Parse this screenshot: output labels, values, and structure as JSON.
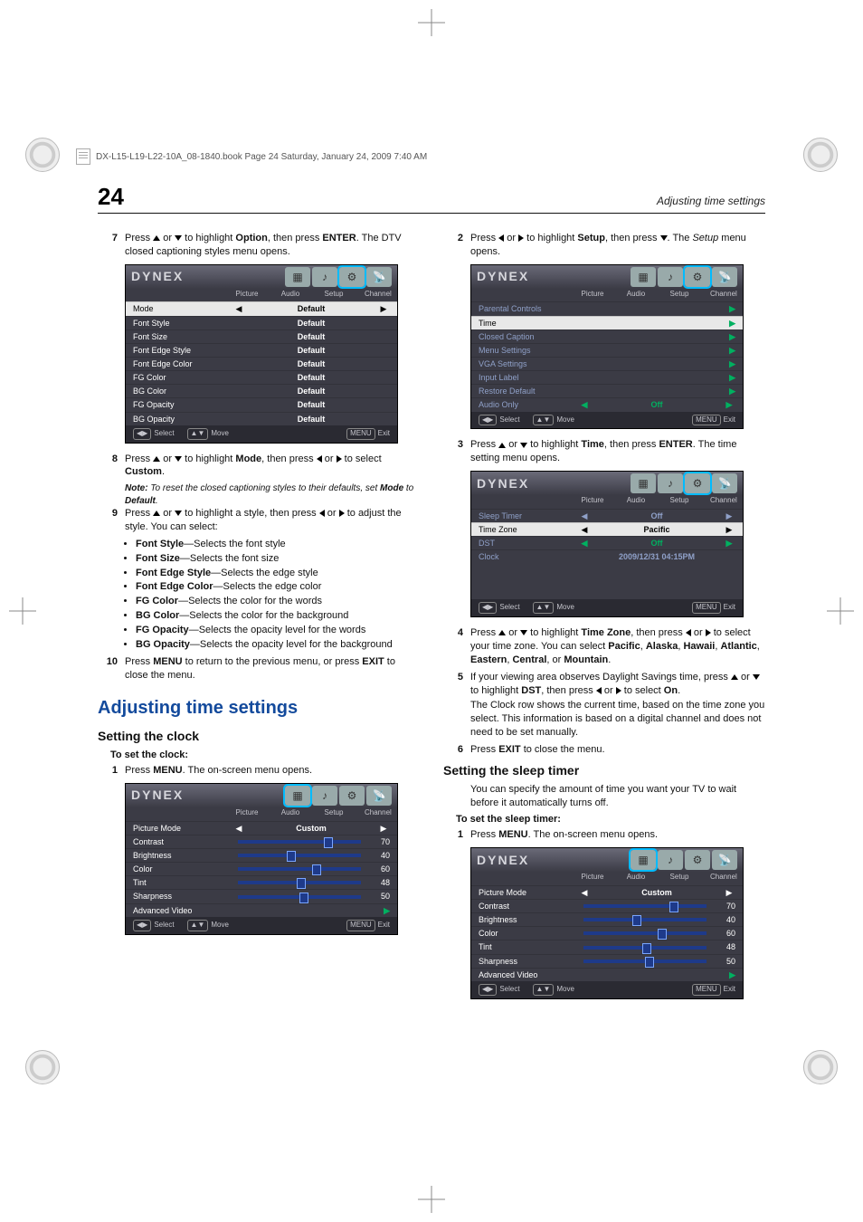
{
  "header_strip": "DX-L15-L19-L22-10A_08-1840.book  Page 24  Saturday, January 24, 2009  7:40 AM",
  "page_number": "24",
  "running_head": "Adjusting time settings",
  "brand": "DYNEX",
  "tab_labels": {
    "picture": "Picture",
    "audio": "Audio",
    "setup": "Setup",
    "channel": "Channel"
  },
  "osd_foot": {
    "select": "Select",
    "move": "Move",
    "menu": "MENU",
    "exit": "Exit"
  },
  "left": {
    "step7_a": "Press ",
    "step7_b": " or ",
    "step7_c": " to highlight ",
    "step7_opt": "Option",
    "step7_d": ", then press ",
    "step7_enter": "ENTER",
    "step7_e": ". The DTV closed captioning styles menu opens.",
    "osd1": {
      "rows": [
        {
          "k": "Mode",
          "v": "Default",
          "hl": true,
          "arrows": true
        },
        {
          "k": "Font Style",
          "v": "Default"
        },
        {
          "k": "Font Size",
          "v": "Default"
        },
        {
          "k": "Font Edge Style",
          "v": "Default"
        },
        {
          "k": "Font Edge Color",
          "v": "Default"
        },
        {
          "k": "FG Color",
          "v": "Default"
        },
        {
          "k": "BG Color",
          "v": "Default"
        },
        {
          "k": "FG Opacity",
          "v": "Default"
        },
        {
          "k": "BG Opacity",
          "v": "Default"
        }
      ]
    },
    "step8_a": "Press ",
    "step8_b": " or ",
    "step8_c": " to highlight ",
    "step8_mode": "Mode",
    "step8_d": ", then press ",
    "step8_e": " or ",
    "step8_f": " to select ",
    "step8_custom": "Custom",
    "note_a": "Note:",
    "note_b": " To reset the closed captioning styles to their defaults, set ",
    "note_c": "Mode",
    "note_d": " to ",
    "note_e": "Default",
    "step9_a": "Press ",
    "step9_b": " or ",
    "step9_c": " to highlight a style, then press ",
    "step9_d": " or ",
    "step9_e": " to adjust the style. You can select:",
    "b1": "Font Style",
    "b1t": "—Selects the font style",
    "b2": "Font Size",
    "b2t": "—Selects the font size",
    "b3": "Font Edge Style",
    "b3t": "—Selects the edge style",
    "b4": "Font Edge Color",
    "b4t": "—Selects the edge color",
    "b5": "FG Color",
    "b5t": "—Selects the color for the words",
    "b6": "BG Color",
    "b6t": "—Selects the color for the background",
    "b7": "FG Opacity",
    "b7t": "—Selects the opacity level for the words",
    "b8": "BG Opacity",
    "b8t": "—Selects the opacity level for the background",
    "step10_a": "Press ",
    "step10_menu": "MENU",
    "step10_b": " to return to the previous menu, or press ",
    "step10_exit": "EXIT",
    "step10_c": " to close the menu.",
    "h1": "Adjusting time settings",
    "h2": "Setting the clock",
    "proc": "To set the clock:",
    "s1_a": "Press ",
    "s1_menu": "MENU",
    "s1_b": ". The on-screen menu opens.",
    "osd2": {
      "rows": [
        {
          "k": "Picture Mode",
          "v": "Custom",
          "arrows": true
        },
        {
          "k": "Contrast",
          "slider": 70,
          "rv": "70"
        },
        {
          "k": "Brightness",
          "slider": 40,
          "rv": "40"
        },
        {
          "k": "Color",
          "slider": 60,
          "rv": "60"
        },
        {
          "k": "Tint",
          "slider": 48,
          "rv": "48"
        },
        {
          "k": "Sharpness",
          "slider": 50,
          "rv": "50"
        },
        {
          "k": "Advanced Video",
          "chev": true
        }
      ]
    }
  },
  "right": {
    "s2_a": "Press ",
    "s2_b": " or ",
    "s2_c": " to highlight ",
    "s2_setup": "Setup",
    "s2_d": ", then press ",
    "s2_e": ". The ",
    "s2_sem": "Setup",
    "s2_f": " menu opens.",
    "osd3": {
      "rows": [
        {
          "k": "Parental Controls",
          "chev": true,
          "dim": true
        },
        {
          "k": "Time",
          "chev": true,
          "hl": true
        },
        {
          "k": "Closed Caption",
          "chev": true,
          "dim": true
        },
        {
          "k": "Menu Settings",
          "chev": true,
          "dim": true
        },
        {
          "k": "VGA Settings",
          "chev": true,
          "dim": true
        },
        {
          "k": "Input Label",
          "chev": true,
          "dim": true
        },
        {
          "k": "Restore Default",
          "chev": true,
          "dim": true
        },
        {
          "k": "Audio Only",
          "v": "Off",
          "arrows": true,
          "green": true,
          "dim": true
        }
      ]
    },
    "s3_a": "Press ",
    "s3_b": " or ",
    "s3_c": " to highlight ",
    "s3_time": "Time",
    "s3_d": ", then press ",
    "s3_enter": "ENTER",
    "s3_e": ". The time setting menu opens.",
    "osd4": {
      "rows": [
        {
          "k": "Sleep Timer",
          "v": "Off",
          "arrows": true,
          "dim": true
        },
        {
          "k": "Time Zone",
          "v": "Pacific",
          "arrows": true,
          "hl": true
        },
        {
          "k": "DST",
          "v": "Off",
          "arrows": true,
          "green": true,
          "dim": true
        },
        {
          "k": "Clock",
          "v": "2009/12/31 04:15PM",
          "dim": true
        }
      ]
    },
    "s4_a": "Press ",
    "s4_b": " or ",
    "s4_c": " to highlight ",
    "s4_tz": "Time Zone",
    "s4_d": ", then press ",
    "s4_e": " or ",
    "s4_f": " to select your time zone. You can select ",
    "tz1": "Pacific",
    "tz2": "Alaska",
    "tz3": "Hawaii",
    "tz4": "Atlantic",
    "tz5": "Eastern",
    "tz6": "Central",
    "tz7": "Mountain",
    "comma": ", ",
    "or": ", or ",
    "period": ".",
    "s5_a": "If your viewing area observes Daylight Savings time, press ",
    "s5_b": " or ",
    "s5_c": " to highlight ",
    "s5_dst": "DST",
    "s5_d": ", then press ",
    "s5_e": " or ",
    "s5_f": " to select ",
    "s5_on": "On",
    "s5_g": ".",
    "s5_tail": "The Clock row shows the current time, based on the time zone you select. This information is based on a digital channel and does not need to be set manually.",
    "s6_a": "Press ",
    "s6_exit": "EXIT",
    "s6_b": " to close the menu.",
    "h2b": "Setting the sleep timer",
    "intro": "You can specify the amount of time you want your TV to wait before it automatically turns off.",
    "proc2": "To set the sleep timer:",
    "sr1_a": "Press ",
    "sr1_menu": "MENU",
    "sr1_b": ". The on-screen menu opens.",
    "osd5": {
      "rows": [
        {
          "k": "Picture Mode",
          "v": "Custom",
          "arrows": true
        },
        {
          "k": "Contrast",
          "slider": 70,
          "rv": "70"
        },
        {
          "k": "Brightness",
          "slider": 40,
          "rv": "40"
        },
        {
          "k": "Color",
          "slider": 60,
          "rv": "60"
        },
        {
          "k": "Tint",
          "slider": 48,
          "rv": "48"
        },
        {
          "k": "Sharpness",
          "slider": 50,
          "rv": "50"
        },
        {
          "k": "Advanced Video",
          "chev": true
        }
      ]
    }
  }
}
